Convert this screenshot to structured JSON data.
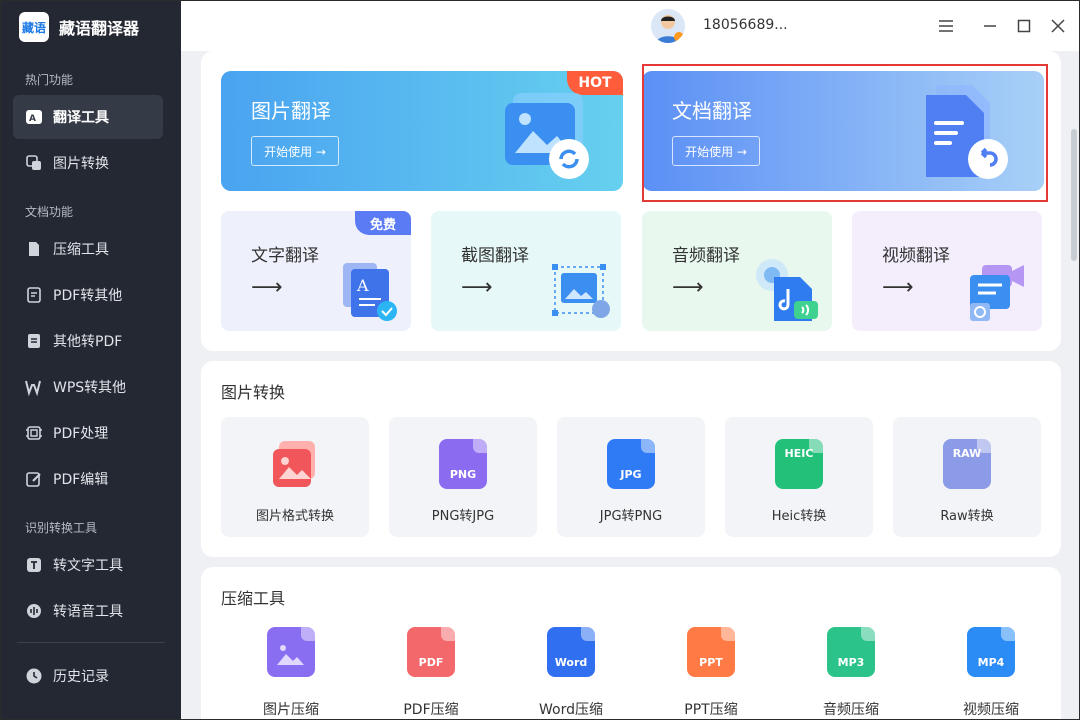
{
  "app": {
    "logo_text": "藏语",
    "name": "藏语翻译器"
  },
  "sidebar": {
    "sections": [
      {
        "title": "热门功能",
        "items": [
          {
            "label": "翻译工具",
            "icon": "translate-icon",
            "active": true
          },
          {
            "label": "图片转换",
            "icon": "image-convert-icon"
          }
        ]
      },
      {
        "title": "文档功能",
        "items": [
          {
            "label": "压缩工具",
            "icon": "compress-icon"
          },
          {
            "label": "PDF转其他",
            "icon": "pdf-convert-icon"
          },
          {
            "label": "其他转PDF",
            "icon": "to-pdf-icon"
          },
          {
            "label": "WPS转其他",
            "icon": "wps-icon"
          },
          {
            "label": "PDF处理",
            "icon": "pdf-process-icon"
          },
          {
            "label": "PDF编辑",
            "icon": "pdf-edit-icon"
          }
        ]
      },
      {
        "title": "识别转换工具",
        "items": [
          {
            "label": "转文字工具",
            "icon": "text-tool-icon"
          },
          {
            "label": "转语音工具",
            "icon": "voice-tool-icon"
          }
        ]
      }
    ],
    "history": {
      "label": "历史记录",
      "icon": "clock-icon"
    }
  },
  "header": {
    "phone": "18056689..."
  },
  "translate": {
    "big_cards": [
      {
        "title": "图片翻译",
        "start": "开始使用 →",
        "badge": "HOT"
      },
      {
        "title": "文档翻译",
        "start": "开始使用 →"
      }
    ],
    "small_cards": [
      {
        "title": "文字翻译",
        "arrow": "⟶",
        "badge": "免费"
      },
      {
        "title": "截图翻译",
        "arrow": "⟶"
      },
      {
        "title": "音频翻译",
        "arrow": "⟶"
      },
      {
        "title": "视频翻译",
        "arrow": "⟶"
      }
    ]
  },
  "image_convert": {
    "title": "图片转换",
    "items": [
      {
        "label": "图片格式转换",
        "tag": "",
        "color": "#f0565a"
      },
      {
        "label": "PNG转JPG",
        "tag": "PNG",
        "color": "#8b6cf0"
      },
      {
        "label": "JPG转PNG",
        "tag": "JPG",
        "color": "#2f7bf5"
      },
      {
        "label": "Heic转换",
        "tag": "HEIC",
        "color": "#23c07a"
      },
      {
        "label": "Raw转换",
        "tag": "RAW",
        "color": "#8c9be8"
      }
    ]
  },
  "compress": {
    "title": "压缩工具",
    "items": [
      {
        "label": "图片压缩",
        "tag": "",
        "color": "#8a6ef2"
      },
      {
        "label": "PDF压缩",
        "tag": "PDF",
        "color": "#f2686b"
      },
      {
        "label": "Word压缩",
        "tag": "Word",
        "color": "#2f6ff0"
      },
      {
        "label": "PPT压缩",
        "tag": "PPT",
        "color": "#ff7a45"
      },
      {
        "label": "音频压缩",
        "tag": "MP3",
        "color": "#2bc38a"
      },
      {
        "label": "视频压缩",
        "tag": "MP4",
        "color": "#2a8cf4"
      }
    ]
  }
}
